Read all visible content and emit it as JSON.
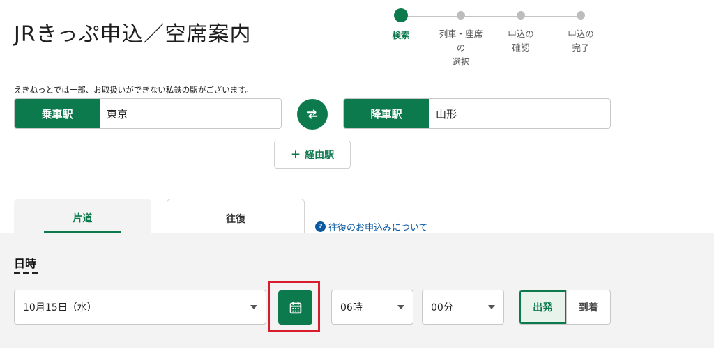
{
  "page": {
    "title": "JRきっぷ申込／空席案内"
  },
  "steps": [
    {
      "label": "検索"
    },
    {
      "label": "列車・座席の\n選択"
    },
    {
      "label": "申込の\n確認"
    },
    {
      "label": "申込の\n完了"
    }
  ],
  "notice": "えきねっとでは一部、お取扱いができない私鉄の駅がございます。",
  "search": {
    "from_label": "乗車駅",
    "from_value": "東京",
    "to_label": "降車駅",
    "to_value": "山形",
    "via_label": "経由駅",
    "via_icon": "plus-icon",
    "swap_icon": "swap-arrows-icon"
  },
  "tabs": {
    "oneway": "片道",
    "round": "往復",
    "help_link": "往復のお申込みについて",
    "help_icon": "question-icon"
  },
  "datetime": {
    "title": "日時",
    "date": "10月15日（水）",
    "hour": "06時",
    "minute": "00分",
    "depart": "出発",
    "arrive": "到着",
    "calendar_icon": "calendar-icon"
  },
  "colors": {
    "brand": "#0d7a4e",
    "link": "#0a59a0",
    "highlight": "#d81e2c"
  }
}
